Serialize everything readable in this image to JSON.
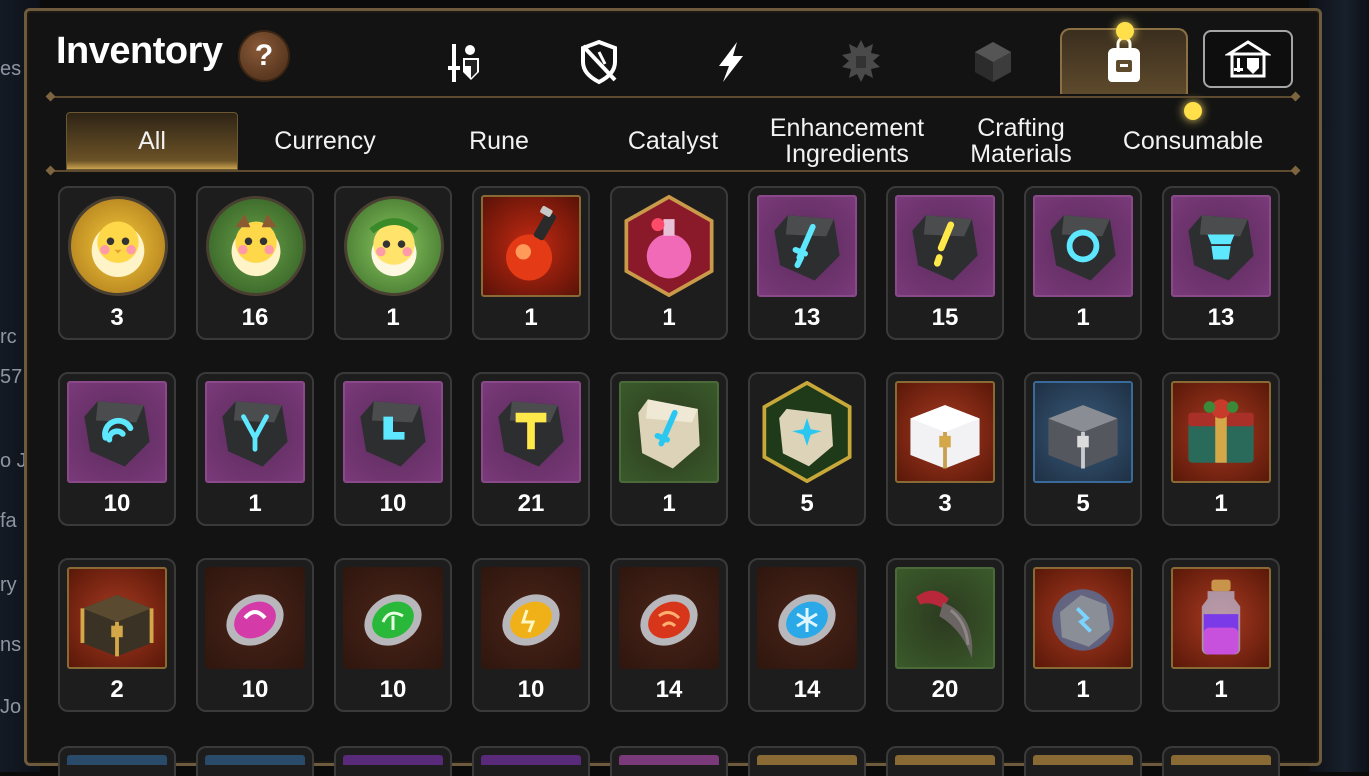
{
  "window": {
    "title": "Inventory",
    "help_label": "?"
  },
  "background_fragments": [
    "es",
    "rc",
    "57",
    "o J",
    "fa",
    "ry",
    "ns",
    "Jo"
  ],
  "top_tabs": [
    {
      "icon": "knight-shield-icon",
      "active": false
    },
    {
      "icon": "broken-shield-icon",
      "active": false
    },
    {
      "icon": "lightning-icon",
      "active": false
    },
    {
      "icon": "spiky-emblem-icon",
      "active": false
    },
    {
      "icon": "cube-icon",
      "active": false
    },
    {
      "icon": "backpack-icon",
      "active": true
    },
    {
      "icon": "shop-icon",
      "active": false
    }
  ],
  "category_tabs": [
    {
      "label": "All",
      "active": true
    },
    {
      "label": "Currency",
      "active": false
    },
    {
      "label": "Rune",
      "active": false
    },
    {
      "label": "Catalyst",
      "active": false
    },
    {
      "label": "Enhancement\nIngredients",
      "active": false
    },
    {
      "label": "Crafting\nMaterials",
      "active": false
    },
    {
      "label": "Consumable",
      "active": false
    }
  ],
  "colors": {
    "panel_border": "#6e5a3c",
    "active_tab": "#6b5226",
    "notification_dot": "#ffdf4a",
    "rarity_purple": "#7a3a7a",
    "rarity_red": "#8a2418",
    "rarity_green": "#3a5a2a",
    "rarity_blue": "#2a4a6a"
  },
  "items": [
    [
      {
        "name": "gold-mascot-token",
        "count": "3"
      },
      {
        "name": "green-mascot-token",
        "count": "16"
      },
      {
        "name": "laurel-mascot-token",
        "count": "1"
      },
      {
        "name": "red-potion-flask",
        "count": "1"
      },
      {
        "name": "pink-potion-flask",
        "count": "1"
      },
      {
        "name": "sword-rune-stone",
        "count": "13"
      },
      {
        "name": "bolt-rune-stone",
        "count": "15"
      },
      {
        "name": "ring-rune-stone",
        "count": "1"
      },
      {
        "name": "armor-rune-stone",
        "count": "13"
      }
    ],
    [
      {
        "name": "helm-rune-stone",
        "count": "10"
      },
      {
        "name": "necklace-rune-stone",
        "count": "1"
      },
      {
        "name": "boot-rune-stone",
        "count": "10"
      },
      {
        "name": "hammer-rune-stone",
        "count": "21"
      },
      {
        "name": "sword-catalyst-stone",
        "count": "1"
      },
      {
        "name": "star-catalyst-stone",
        "count": "5"
      },
      {
        "name": "white-gold-chest",
        "count": "3"
      },
      {
        "name": "silver-chest",
        "count": "5"
      },
      {
        "name": "gift-chest",
        "count": "1"
      }
    ],
    [
      {
        "name": "dark-treasure-chest",
        "count": "2"
      },
      {
        "name": "purple-gem",
        "count": "10"
      },
      {
        "name": "green-gem",
        "count": "10"
      },
      {
        "name": "yellow-gem",
        "count": "10"
      },
      {
        "name": "red-gem",
        "count": "14"
      },
      {
        "name": "blue-gem",
        "count": "14"
      },
      {
        "name": "beast-claw",
        "count": "20"
      },
      {
        "name": "lightning-ore",
        "count": "1"
      },
      {
        "name": "purple-elixir-bottle",
        "count": "1"
      }
    ]
  ]
}
